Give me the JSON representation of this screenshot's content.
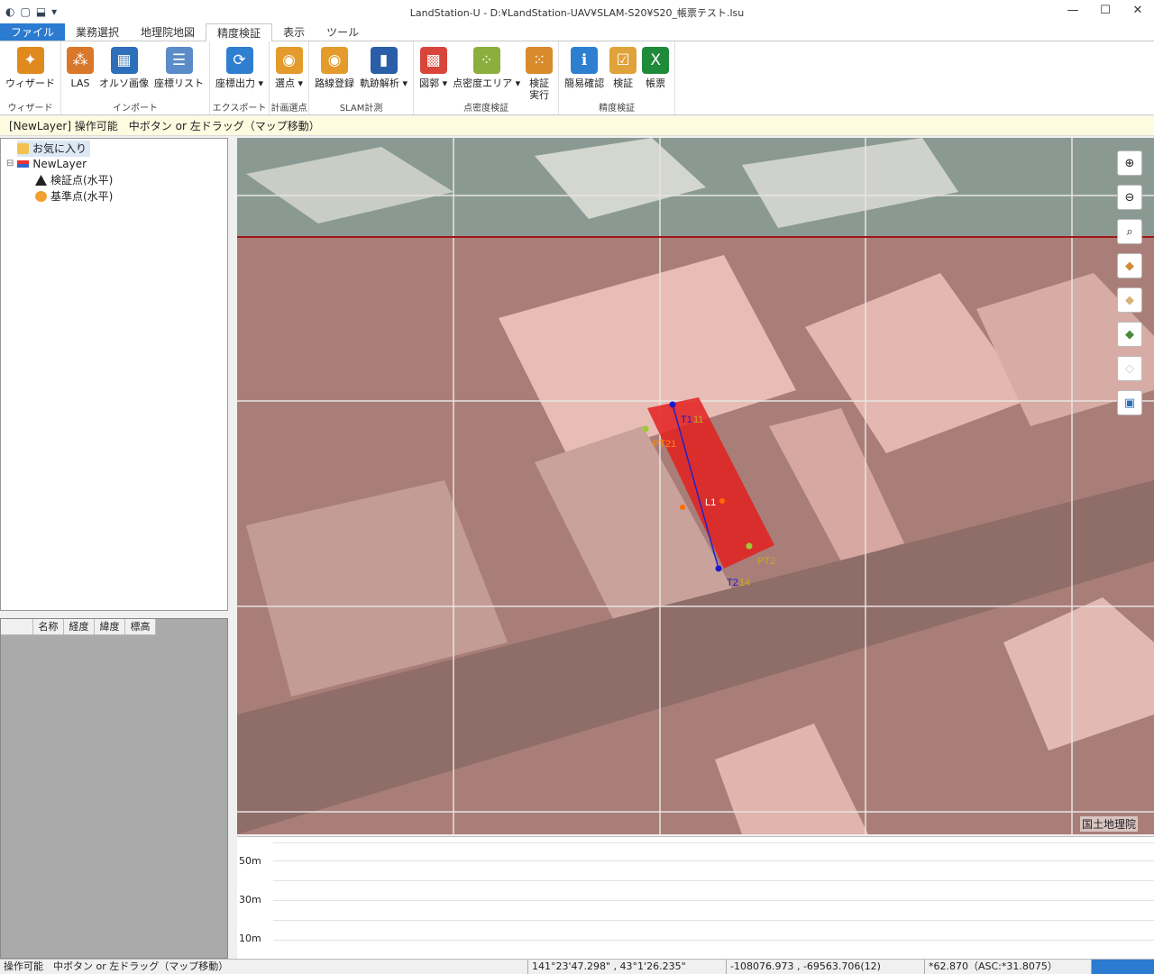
{
  "window": {
    "title": "LandStation-U - D:¥LandStation-UAV¥SLAM-S20¥S20_帳票テスト.lsu",
    "minimize": "—",
    "maximize": "☐",
    "close": "✕"
  },
  "quick_access": [
    "◐",
    "▢",
    "⬓",
    "▾"
  ],
  "tabs": [
    {
      "label": "ファイル"
    },
    {
      "label": "業務選択"
    },
    {
      "label": "地理院地図"
    },
    {
      "label": "精度検証"
    },
    {
      "label": "表示"
    },
    {
      "label": "ツール"
    }
  ],
  "ribbon": {
    "groups": [
      {
        "label": "ウィザード",
        "buttons": [
          {
            "label": "ウィザード",
            "color": "#e08a1e",
            "glyph": "✦"
          }
        ]
      },
      {
        "label": "インポート",
        "buttons": [
          {
            "label": "LAS",
            "color": "#d9772a",
            "glyph": "⁂"
          },
          {
            "label": "オルソ画像",
            "color": "#2d6fb8",
            "glyph": "▦"
          },
          {
            "label": "座標リスト",
            "color": "#5b8bc9",
            "glyph": "☰"
          }
        ]
      },
      {
        "label": "エクスポート",
        "buttons": [
          {
            "label": "座標出力 ▾",
            "color": "#2f7fd0",
            "glyph": "⟳"
          }
        ]
      },
      {
        "label": "計画選点",
        "buttons": [
          {
            "label": "選点 ▾",
            "color": "#e39b2b",
            "glyph": "◉"
          }
        ]
      },
      {
        "label": "SLAM計測",
        "buttons": [
          {
            "label": "路線登録",
            "color": "#e39b2b",
            "glyph": "◉"
          },
          {
            "label": "軌跡解析 ▾",
            "color": "#2a5fa8",
            "glyph": "▮"
          }
        ]
      },
      {
        "label": "点密度検証",
        "buttons": [
          {
            "label": "図郭 ▾",
            "color": "#d8453a",
            "glyph": "▩"
          },
          {
            "label": "点密度エリア ▾",
            "color": "#8cae3e",
            "glyph": "⁘"
          },
          {
            "label": "検証\n実行",
            "color": "#d98a2b",
            "glyph": "⁙"
          }
        ]
      },
      {
        "label": "精度検証",
        "buttons": [
          {
            "label": "簡易確認",
            "color": "#2f7fd0",
            "glyph": "ℹ"
          },
          {
            "label": "検証",
            "color": "#e0a23a",
            "glyph": "☑"
          },
          {
            "label": "帳票",
            "color": "#1f8a3a",
            "glyph": "X"
          }
        ]
      }
    ]
  },
  "infobar": "[NewLayer] 操作可能　中ボタン or 左ドラッグ（マップ移動）",
  "tree": {
    "favorites": "お気に入り",
    "layer": "NewLayer",
    "expander": "⊟",
    "items": [
      "検証点(水平)",
      "基準点(水平)"
    ]
  },
  "point_table": {
    "columns": [
      "",
      "名称",
      "経度",
      "緯度",
      "標高"
    ]
  },
  "map": {
    "attribution": "国土地理院",
    "labels": [
      "T1",
      "11",
      "PT21",
      "L1",
      "T2",
      "14",
      "PT2"
    ],
    "tools": [
      "zoom-in",
      "zoom-out",
      "zoom-fit",
      "layer-a",
      "layer-b",
      "layer-c",
      "layer-d",
      "camera"
    ],
    "colors": {
      "area_overlay": "#f0a0a0",
      "polygon": "#e32020",
      "line": "#2222cc",
      "point_green": "#9acd32",
      "point_orange": "#ff6a00"
    }
  },
  "profile": {
    "ticks": [
      "50m",
      "30m",
      "10m"
    ]
  },
  "status": {
    "mode": "操作可能　中ボタン or 左ドラッグ（マップ移動）",
    "latlon": "141°23'47.298\" , 43°1'26.235\"",
    "xy": "-108076.973 , -69563.706(12)",
    "height": "*62.870（ASC:*31.8075）"
  }
}
